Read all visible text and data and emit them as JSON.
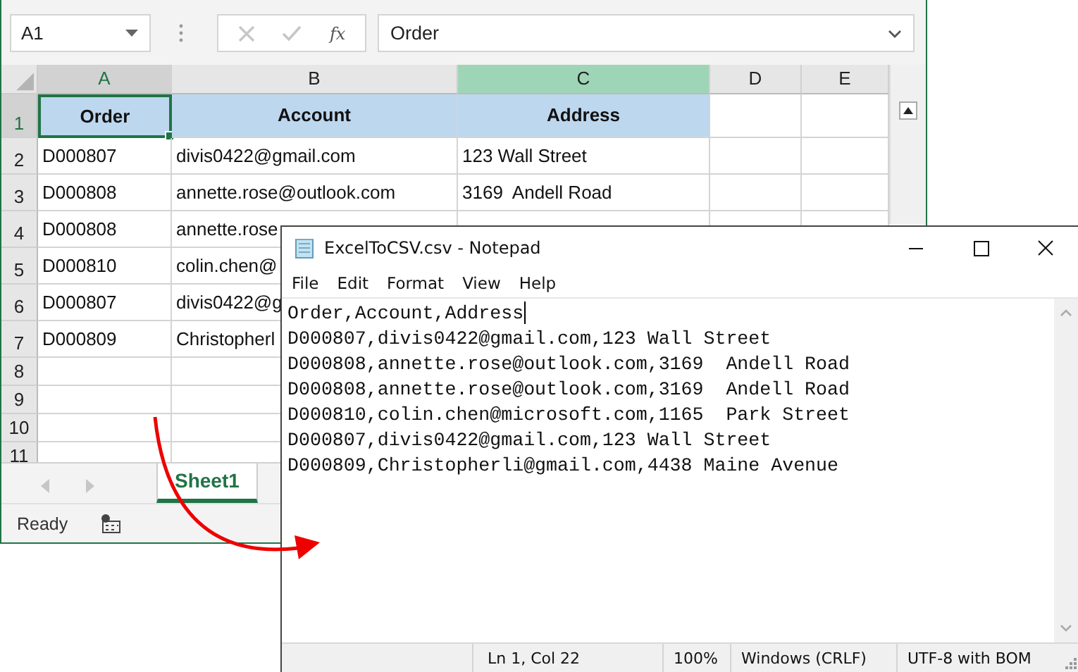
{
  "excel": {
    "name_box": "A1",
    "formula_function": "fx",
    "formula_value": "Order",
    "columns": [
      {
        "label": "A",
        "active": true,
        "selected": false
      },
      {
        "label": "B",
        "active": false,
        "selected": false
      },
      {
        "label": "C",
        "active": false,
        "selected": true
      },
      {
        "label": "D",
        "active": false,
        "selected": false
      },
      {
        "label": "E",
        "active": false,
        "selected": false
      }
    ],
    "rows": [
      {
        "label": "1",
        "kind": "header",
        "active": true,
        "cells": [
          {
            "text": "Order",
            "active": true
          },
          {
            "text": "Account",
            "active": false
          },
          {
            "text": "Address",
            "active": false
          }
        ]
      },
      {
        "label": "2",
        "kind": "data",
        "active": false,
        "cells": [
          {
            "text": "D000807",
            "active": false
          },
          {
            "text": "divis0422@gmail.com",
            "active": false
          },
          {
            "text": "123 Wall Street",
            "active": false
          }
        ]
      },
      {
        "label": "3",
        "kind": "data",
        "active": false,
        "cells": [
          {
            "text": "D000808",
            "active": false
          },
          {
            "text": "annette.rose@outlook.com",
            "active": false
          },
          {
            "text": "3169  Andell Road",
            "active": false
          }
        ]
      },
      {
        "label": "4",
        "kind": "data",
        "active": false,
        "cells": [
          {
            "text": "D000808",
            "active": false
          },
          {
            "text": "annette.rose",
            "active": false
          }
        ]
      },
      {
        "label": "5",
        "kind": "data",
        "active": false,
        "cells": [
          {
            "text": "D000810",
            "active": false
          },
          {
            "text": "colin.chen@",
            "active": false
          }
        ]
      },
      {
        "label": "6",
        "kind": "data",
        "active": false,
        "cells": [
          {
            "text": "D000807",
            "active": false
          },
          {
            "text": "divis0422@g",
            "active": false
          }
        ]
      },
      {
        "label": "7",
        "kind": "data",
        "active": false,
        "cells": [
          {
            "text": "D000809",
            "active": false
          },
          {
            "text": "Christopherl",
            "active": false
          }
        ]
      },
      {
        "label": "8",
        "kind": "empty",
        "active": false
      },
      {
        "label": "9",
        "kind": "empty",
        "active": false
      },
      {
        "label": "10",
        "kind": "empty",
        "active": false
      },
      {
        "label": "11",
        "kind": "empty",
        "active": false
      }
    ],
    "sheet_tabs": [
      {
        "label": "Sheet1",
        "selected": true
      }
    ],
    "status": "Ready"
  },
  "notepad": {
    "title": "ExcelToCSV.csv - Notepad",
    "menu": [
      "File",
      "Edit",
      "Format",
      "View",
      "Help"
    ],
    "lines": [
      {
        "text": "Order,Account,Address",
        "caret": true
      },
      {
        "text": "D000807,divis0422@gmail.com,123 Wall Street",
        "caret": false
      },
      {
        "text": "D000808,annette.rose@outlook.com,3169  Andell Road",
        "caret": false
      },
      {
        "text": "D000808,annette.rose@outlook.com,3169  Andell Road",
        "caret": false
      },
      {
        "text": "D000810,colin.chen@microsoft.com,1165  Park Street",
        "caret": false
      },
      {
        "text": "D000807,divis0422@gmail.com,123 Wall Street",
        "caret": false
      },
      {
        "text": "D000809,Christopherli@gmail.com,4438 Maine Avenue",
        "caret": false
      }
    ],
    "status": {
      "position": "Ln 1, Col 22",
      "zoom": "100%",
      "line_ending": "Windows (CRLF)",
      "encoding": "UTF-8 with BOM"
    }
  }
}
